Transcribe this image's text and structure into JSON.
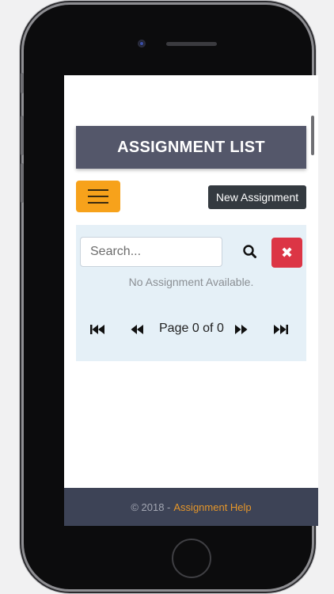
{
  "app": {
    "header_title": "ASSIGNMENT LIST",
    "new_button_label": "New Assignment"
  },
  "search": {
    "placeholder": "Search...",
    "value": ""
  },
  "list": {
    "empty_message": "No Assignment Available."
  },
  "pagination": {
    "label": "Page 0 of 0"
  },
  "footer": {
    "copyright": "© 2018 -",
    "link_text": "Assignment Help"
  },
  "icons": {
    "menu": "hamburger-menu-icon",
    "search": "search-icon",
    "clear": "close-icon",
    "first": "skip-first-icon",
    "prev": "rewind-icon",
    "next": "fast-forward-icon",
    "last": "skip-last-icon"
  },
  "colors": {
    "header_bg": "#54576a",
    "menu_button": "#f7a21b",
    "new_button": "#343a40",
    "clear_button": "#dc3545",
    "panel_bg": "#e5f0f7",
    "footer_bg": "#3d4356",
    "footer_link": "#e5962a"
  }
}
